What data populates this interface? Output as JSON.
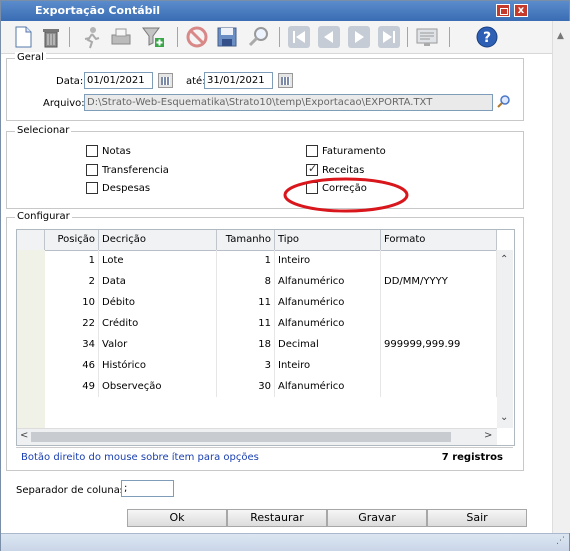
{
  "window": {
    "title": "Exportação Contábil"
  },
  "toolbar": {
    "icons": [
      "new-document-icon",
      "trash-icon",
      "run-icon",
      "printer-icon",
      "filter-add-icon",
      "cancel-icon",
      "save-icon",
      "search-icon",
      "first-record-icon",
      "previous-record-icon",
      "next-record-icon",
      "last-record-icon",
      "view-icon",
      "help-icon"
    ]
  },
  "geral": {
    "legend": "Geral",
    "data_label": "Data:",
    "data_from": "01/01/2021",
    "ate_label": "até:",
    "data_to": "31/01/2021",
    "arquivo_label": "Arquivo:",
    "arquivo_value": "D:\\Strato-Web-Esquematika\\Strato10\\temp\\Exportacao\\EXPORTA.TXT"
  },
  "selecionar": {
    "legend": "Selecionar",
    "items": [
      {
        "label": "Notas",
        "checked": false
      },
      {
        "label": "Transferencia",
        "checked": false
      },
      {
        "label": "Despesas",
        "checked": false
      },
      {
        "label": "Faturamento",
        "checked": false
      },
      {
        "label": "Receitas",
        "checked": true
      },
      {
        "label": "Correção",
        "checked": false
      }
    ]
  },
  "configurar": {
    "legend": "Configurar",
    "columns": [
      "Posição",
      "Decrição",
      "Tamanho",
      "Tipo",
      "Formato"
    ],
    "rows": [
      {
        "pos": "1",
        "desc": "Lote",
        "tam": "1",
        "tipo": "Inteiro",
        "fmt": ""
      },
      {
        "pos": "2",
        "desc": "Data",
        "tam": "8",
        "tipo": "Alfanumérico",
        "fmt": "DD/MM/YYYY"
      },
      {
        "pos": "10",
        "desc": "Débito",
        "tam": "11",
        "tipo": "Alfanumérico",
        "fmt": ""
      },
      {
        "pos": "22",
        "desc": "Crédito",
        "tam": "11",
        "tipo": "Alfanumérico",
        "fmt": ""
      },
      {
        "pos": "34",
        "desc": "Valor",
        "tam": "18",
        "tipo": "Decimal",
        "fmt": "999999,999.99"
      },
      {
        "pos": "46",
        "desc": "Histórico",
        "tam": "3",
        "tipo": "Inteiro",
        "fmt": ""
      },
      {
        "pos": "49",
        "desc": "Observeção",
        "tam": "30",
        "tipo": "Alfanumérico",
        "fmt": ""
      }
    ],
    "hint": "Botão direito do mouse sobre ítem para opções",
    "count": "7 registros"
  },
  "separador": {
    "label": "Separador de colunas:",
    "value": ";"
  },
  "buttons": {
    "ok": "Ok",
    "restaurar": "Restaurar",
    "gravar": "Gravar",
    "sair": "Sair"
  },
  "colors": {
    "title_bar": "#3a6cb4",
    "hint_text": "#1a3fb0",
    "annotation": "#d8161c"
  }
}
